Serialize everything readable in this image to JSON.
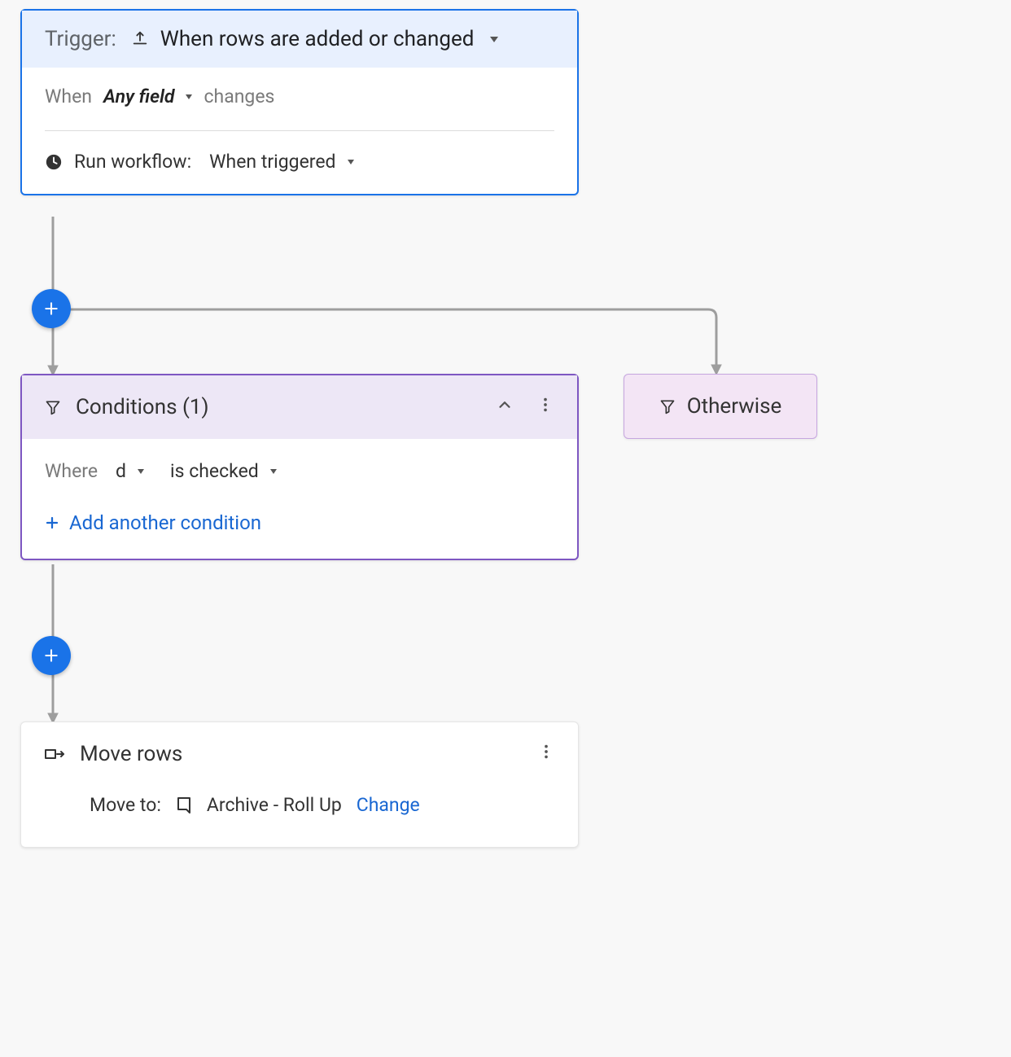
{
  "trigger": {
    "label": "Trigger:",
    "type": "When rows are added or changed",
    "when_label": "When",
    "when_field": "Any field",
    "when_verb": "changes",
    "run_label": "Run workflow:",
    "run_value": "When triggered"
  },
  "conditions": {
    "title": "Conditions (1)",
    "where_label": "Where",
    "where_field": "d",
    "where_operator": "is checked",
    "add_label": "Add another condition"
  },
  "otherwise": {
    "label": "Otherwise"
  },
  "move_rows": {
    "title": "Move rows",
    "move_to_label": "Move to:",
    "destination": "Archive - Roll Up",
    "change_label": "Change"
  }
}
